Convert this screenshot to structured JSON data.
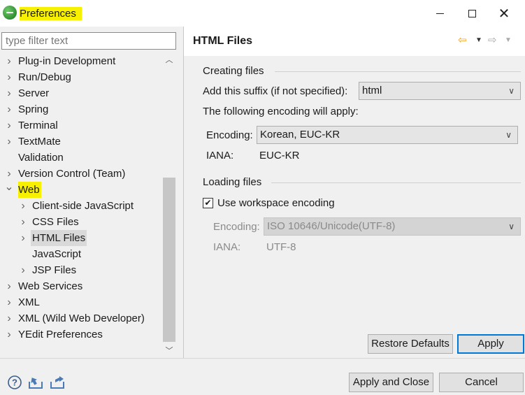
{
  "window": {
    "title": "Preferences"
  },
  "filter": {
    "placeholder": "type filter text",
    "value": ""
  },
  "tree": {
    "items": [
      {
        "label": "Plug-in Development",
        "depth": 0,
        "expander": "collapsed"
      },
      {
        "label": "Run/Debug",
        "depth": 0,
        "expander": "collapsed"
      },
      {
        "label": "Server",
        "depth": 0,
        "expander": "collapsed"
      },
      {
        "label": "Spring",
        "depth": 0,
        "expander": "collapsed"
      },
      {
        "label": "Terminal",
        "depth": 0,
        "expander": "collapsed"
      },
      {
        "label": "TextMate",
        "depth": 0,
        "expander": "collapsed"
      },
      {
        "label": "Validation",
        "depth": 0,
        "expander": "none"
      },
      {
        "label": "Version Control (Team)",
        "depth": 0,
        "expander": "collapsed"
      },
      {
        "label": "Web",
        "depth": 0,
        "expander": "expanded"
      },
      {
        "label": "Client-side JavaScript",
        "depth": 1,
        "expander": "collapsed"
      },
      {
        "label": "CSS Files",
        "depth": 1,
        "expander": "collapsed"
      },
      {
        "label": "HTML Files",
        "depth": 1,
        "expander": "collapsed",
        "selected": true
      },
      {
        "label": "JavaScript",
        "depth": 1,
        "expander": "none"
      },
      {
        "label": "JSP Files",
        "depth": 1,
        "expander": "collapsed"
      },
      {
        "label": "Web Services",
        "depth": 0,
        "expander": "collapsed"
      },
      {
        "label": "XML",
        "depth": 0,
        "expander": "collapsed"
      },
      {
        "label": "XML (Wild Web Developer)",
        "depth": 0,
        "expander": "collapsed"
      },
      {
        "label": "YEdit Preferences",
        "depth": 0,
        "expander": "collapsed"
      }
    ]
  },
  "page": {
    "title": "HTML Files",
    "icons": {
      "back": "back-arrow-icon",
      "forward": "forward-arrow-icon"
    }
  },
  "creating": {
    "group_title": "Creating files",
    "suffix_label": "Add this suffix (if not specified):",
    "suffix_value": "html",
    "encoding_intro": "The following encoding will apply:",
    "encoding_label": "Encoding:",
    "encoding_value": "Korean, EUC-KR",
    "iana_label": "IANA:",
    "iana_value": "EUC-KR"
  },
  "loading": {
    "group_title": "Loading files",
    "checkbox_label": "Use workspace encoding",
    "checkbox_checked": true,
    "encoding_label": "Encoding:",
    "encoding_value": "ISO 10646/Unicode(UTF-8)",
    "iana_label": "IANA:",
    "iana_value": "UTF-8"
  },
  "buttons": {
    "restore_defaults": "Restore Defaults",
    "apply": "Apply",
    "apply_and_close": "Apply and Close",
    "cancel": "Cancel"
  },
  "bottom_icons": [
    "help-icon",
    "import-icon",
    "export-icon"
  ],
  "colors": {
    "highlight": "#f7f000",
    "selection": "#d9d9d9",
    "accent": "#0078d7"
  }
}
